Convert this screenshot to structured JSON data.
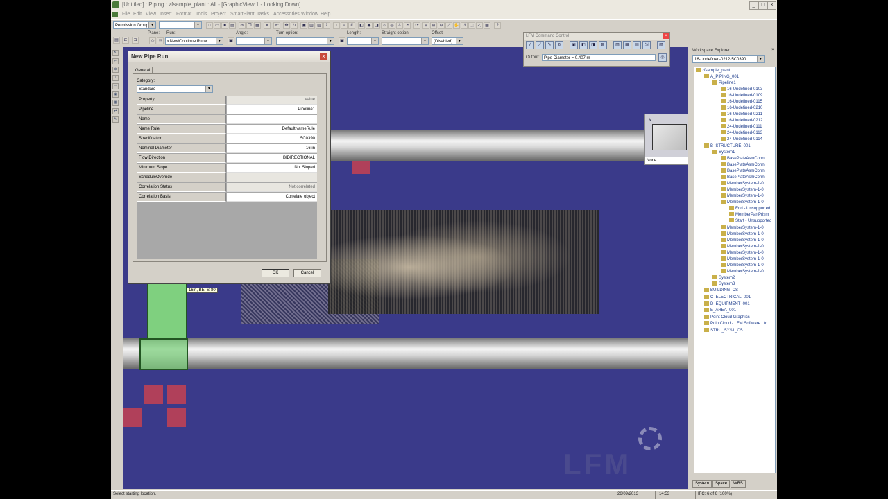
{
  "window": {
    "title": "[Untitled] : Piping : zfsample_plant : All - [GraphicView:1 - Looking Down]",
    "min_label": "_",
    "max_label": "□",
    "close_label": "×"
  },
  "menu": [
    "File",
    "Edit",
    "View",
    "Insert",
    "Format",
    "Tools",
    "Project",
    "SmartPlant",
    "Tasks",
    "Accessories",
    "Window",
    "Help"
  ],
  "toolbar": {
    "permission_group": "Permission Group",
    "second_combo": "",
    "plane_label": "Plane:",
    "run_label": "Run:",
    "run_value": "<New/Continue Run>",
    "angle_label": "Angle:",
    "turn_option_label": "Turn option:",
    "length_label": "Length:",
    "straight_option_label": "Straight option:",
    "offset_label": "Offset:",
    "offset_value": "(Disabled)"
  },
  "lfm_command_control": {
    "title": "LFM Command Control",
    "output_label": "Output:",
    "output_value": "Pipe Diameter = 0.407 m"
  },
  "nav_cube": {
    "north_label": "N",
    "status": "None"
  },
  "workspace_explorer": {
    "title": "Workspace Explorer",
    "filter_value": "16-Undefined-0212-5C0390",
    "tabs": [
      "System",
      "Space",
      "WBS"
    ],
    "items": [
      {
        "label": "zfsample_plant",
        "level": 0
      },
      {
        "label": "A_PIPING_001",
        "level": 1
      },
      {
        "label": "Pipeline1",
        "level": 2
      },
      {
        "label": "16-Undefined-0103",
        "level": 3
      },
      {
        "label": "16-Undefined-0109",
        "level": 3
      },
      {
        "label": "16-Undefined-0115",
        "level": 3
      },
      {
        "label": "16-Undefined-0210",
        "level": 3
      },
      {
        "label": "16-Undefined-0211",
        "level": 3
      },
      {
        "label": "16-Undefined-0212",
        "level": 3
      },
      {
        "label": "24-Undefined-0111",
        "level": 3
      },
      {
        "label": "24-Undefined-0113",
        "level": 3
      },
      {
        "label": "24-Undefined-0114",
        "level": 3
      },
      {
        "label": "B_STRUCTURE_001",
        "level": 1
      },
      {
        "label": "System1",
        "level": 2
      },
      {
        "label": "BasePlateAsmConn",
        "level": 3
      },
      {
        "label": "BasePlateAsmConn",
        "level": 3
      },
      {
        "label": "BasePlateAsmConn",
        "level": 3
      },
      {
        "label": "BasePlateAsmConn",
        "level": 3
      },
      {
        "label": "MemberSystem-1-0",
        "level": 3
      },
      {
        "label": "MemberSystem-1-0",
        "level": 3
      },
      {
        "label": "MemberSystem-1-0",
        "level": 3
      },
      {
        "label": "MemberSystem-1-0",
        "level": 3
      },
      {
        "label": "End - Unsupported",
        "level": 4
      },
      {
        "label": "MemberPartPrism",
        "level": 4
      },
      {
        "label": "Start - Unsupported",
        "level": 4
      },
      {
        "label": "MemberSystem-1-0",
        "level": 3
      },
      {
        "label": "MemberSystem-1-0",
        "level": 3
      },
      {
        "label": "MemberSystem-1-0",
        "level": 3
      },
      {
        "label": "MemberSystem-1-0",
        "level": 3
      },
      {
        "label": "MemberSystem-1-0",
        "level": 3
      },
      {
        "label": "MemberSystem-1-0",
        "level": 3
      },
      {
        "label": "MemberSystem-1-0",
        "level": 3
      },
      {
        "label": "MemberSystem-1-0",
        "level": 3
      },
      {
        "label": "System2",
        "level": 2
      },
      {
        "label": "System3",
        "level": 2
      },
      {
        "label": "BUILDING_CS",
        "level": 1
      },
      {
        "label": "C_ELECTRICAL_001",
        "level": 1
      },
      {
        "label": "D_EQUIPMENT_001",
        "level": 1
      },
      {
        "label": "E_AREA_001",
        "level": 1
      },
      {
        "label": "Point Cloud Graphics",
        "level": 1
      },
      {
        "label": "PointCloud - LFM Software Ltd",
        "level": 1
      },
      {
        "label": "STRU_SYS1_CS",
        "level": 1
      }
    ]
  },
  "dialog": {
    "title": "New Pipe Run",
    "close_label": "×",
    "tab_general": "General",
    "category_label": "Category:",
    "category_value": "Standard",
    "header": {
      "property": "Property",
      "value": "Value"
    },
    "rows": [
      {
        "property": "Pipeline",
        "value": "Pipeline1"
      },
      {
        "property": "Name",
        "value": ""
      },
      {
        "property": "Name Rule",
        "value": "DefaultNameRule"
      },
      {
        "property": "Specification",
        "value": "5C0390"
      },
      {
        "property": "Nominal Diameter",
        "value": "16 in"
      },
      {
        "property": "Flow Direction",
        "value": "BIDIRECTIONAL"
      },
      {
        "property": "Minimum Slope",
        "value": "Not Sloped"
      },
      {
        "property": "ScheduleOverride",
        "value": ""
      },
      {
        "property": "Correlation Status",
        "value": "Not correlated"
      },
      {
        "property": "Correlation Basis",
        "value": "Correlate object"
      }
    ],
    "ok_label": "OK",
    "cancel_label": "Cancel"
  },
  "viewport": {
    "tag_text": "16in, BE, S-80",
    "watermark": "LFM"
  },
  "statusbar": {
    "prompt": "Select starting location.",
    "date": "26/09/2013",
    "time": "14:53",
    "ifc": "IFC: 6 of 6 (100%)"
  }
}
